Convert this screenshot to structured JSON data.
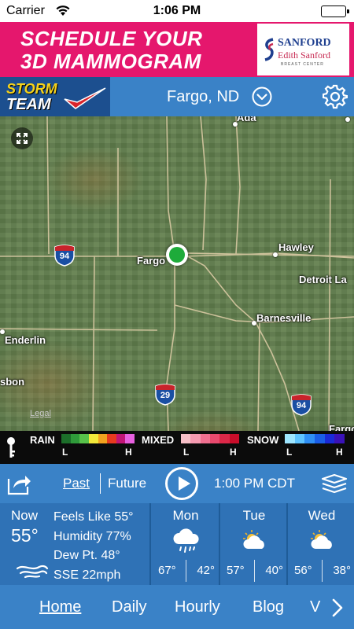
{
  "status_bar": {
    "carrier": "Carrier",
    "time": "1:06 PM"
  },
  "ad": {
    "line1": "SCHEDULE YOUR",
    "line2": "3D MAMMOGRAM",
    "logo_name": "SANFORD",
    "logo_sub": "Edith Sanford",
    "logo_small": "BREAST CENTER",
    "bg_color": "#e5176d"
  },
  "header": {
    "logo_word1": "STORM",
    "logo_word2": "TEAM",
    "location": "Fargo, ND",
    "icons": {
      "dropdown": "chevron-down-circle-icon",
      "settings": "gear-icon"
    }
  },
  "map": {
    "places": [
      "Ada",
      "Hawley",
      "Fargo",
      "Detroit La",
      "Barnesville",
      "Enderlin",
      "sbon",
      "Fargo"
    ],
    "highways": [
      "94",
      "29",
      "94"
    ],
    "legal": "Legal",
    "icons": {
      "fullscreen": "expand-icon",
      "location": "current-location-marker-icon"
    }
  },
  "radar_legend": {
    "rain": "RAIN",
    "mixed": "MIXED",
    "snow": "SNOW",
    "low": "L",
    "high": "H",
    "rain_colors": [
      "#1c6e2a",
      "#2f9a3a",
      "#58c24a",
      "#f3e93a",
      "#f3a21f",
      "#e83a1f",
      "#c21577",
      "#e860e0"
    ],
    "mixed_colors": [
      "#f7c0c8",
      "#f59ab0",
      "#f07090",
      "#e84a6e",
      "#dc2848",
      "#c80d2a"
    ],
    "snow_colors": [
      "#9ee6ff",
      "#5fc4ff",
      "#2f8ff5",
      "#1a5ee8",
      "#1a2ad8",
      "#3a12b8"
    ]
  },
  "playback": {
    "past": "Past",
    "future": "Future",
    "time": "1:00 PM CDT",
    "icons": {
      "share": "share-icon",
      "play": "play-icon",
      "layers": "layers-icon"
    }
  },
  "current": {
    "label": "Now",
    "temp": "55°",
    "feels_like": "Feels Like 55°",
    "humidity": "Humidity  77%",
    "dew_point": "Dew Pt.    48°",
    "wind": "SSE 22mph",
    "icon": "wind-icon"
  },
  "forecast": [
    {
      "day": "Mon",
      "hi": "67°",
      "lo": "42°",
      "icon": "rain-cloud-icon"
    },
    {
      "day": "Tue",
      "hi": "57°",
      "lo": "40°",
      "icon": "partly-cloudy-icon"
    },
    {
      "day": "Wed",
      "hi": "56°",
      "lo": "38°",
      "icon": "partly-cloudy-icon"
    }
  ],
  "nav": {
    "items": [
      "Home",
      "Daily",
      "Hourly",
      "Blog",
      "V"
    ],
    "active": "Home",
    "more_icon": "chevron-right-icon"
  }
}
